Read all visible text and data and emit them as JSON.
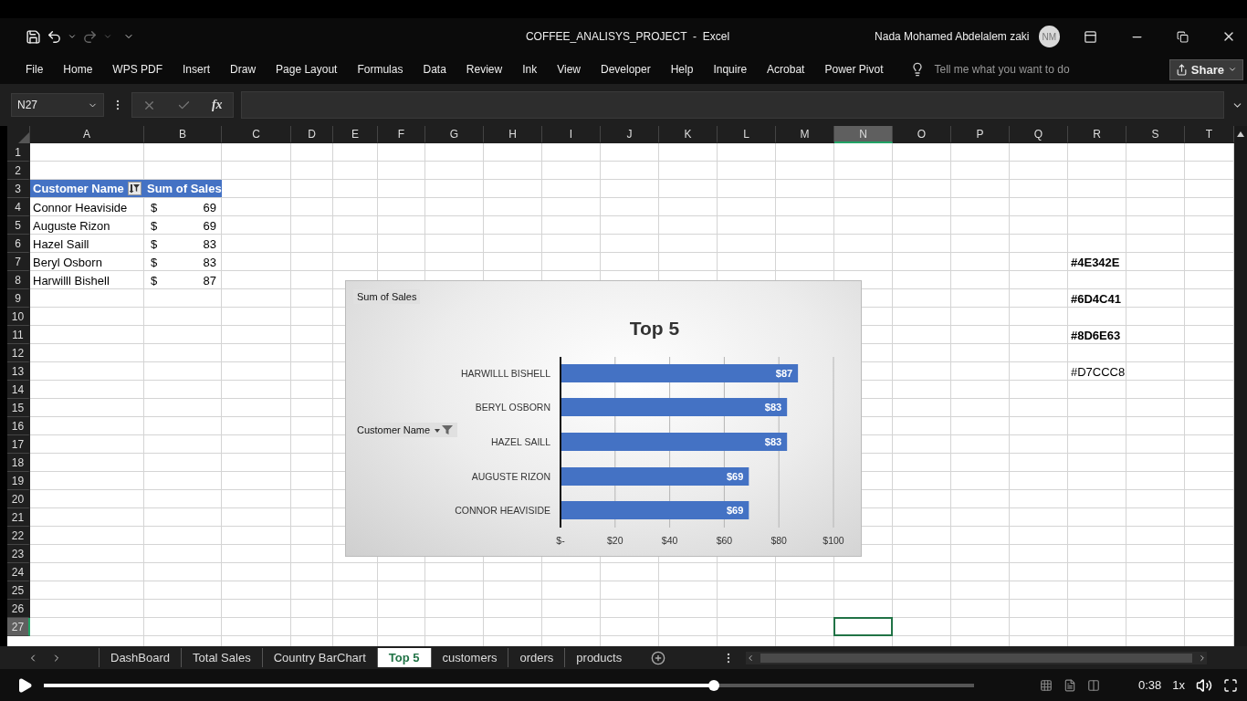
{
  "window": {
    "title": "COFFEE_ANALISYS_PROJECT  -  Excel",
    "user": "Nada Mohamed Abdelalem zaki",
    "avatar": "NM"
  },
  "ribbon_tabs": [
    "File",
    "Home",
    "WPS PDF",
    "Insert",
    "Draw",
    "Page Layout",
    "Formulas",
    "Data",
    "Review",
    "Ink",
    "View",
    "Developer",
    "Help",
    "Inquire",
    "Acrobat",
    "Power Pivot"
  ],
  "tell_me": {
    "placeholder": "Tell me what you want to do"
  },
  "share_button": "Share",
  "name_box": "N27",
  "function_label": "fx",
  "columns": [
    {
      "label": "A",
      "selected": false
    },
    {
      "label": "B",
      "selected": false
    },
    {
      "label": "C",
      "selected": false
    },
    {
      "label": "D",
      "selected": false
    },
    {
      "label": "E",
      "selected": false
    },
    {
      "label": "F",
      "selected": false
    },
    {
      "label": "G",
      "selected": false
    },
    {
      "label": "H",
      "selected": false
    },
    {
      "label": "I",
      "selected": false
    },
    {
      "label": "J",
      "selected": false
    },
    {
      "label": "K",
      "selected": false
    },
    {
      "label": "L",
      "selected": false
    },
    {
      "label": "M",
      "selected": false
    },
    {
      "label": "N",
      "selected": true
    },
    {
      "label": "O",
      "selected": false
    },
    {
      "label": "P",
      "selected": false
    },
    {
      "label": "Q",
      "selected": false
    },
    {
      "label": "R",
      "selected": false
    },
    {
      "label": "S",
      "selected": false
    },
    {
      "label": "T",
      "selected": false
    }
  ],
  "rows": [
    {
      "label": "1",
      "selected": false
    },
    {
      "label": "2",
      "selected": false
    },
    {
      "label": "3",
      "selected": false
    },
    {
      "label": "4",
      "selected": false
    },
    {
      "label": "5",
      "selected": false
    },
    {
      "label": "6",
      "selected": false
    },
    {
      "label": "7",
      "selected": false
    },
    {
      "label": "8",
      "selected": false
    },
    {
      "label": "9",
      "selected": false
    },
    {
      "label": "10",
      "selected": false
    },
    {
      "label": "11",
      "selected": false
    },
    {
      "label": "12",
      "selected": false
    },
    {
      "label": "13",
      "selected": false
    },
    {
      "label": "14",
      "selected": false
    },
    {
      "label": "15",
      "selected": false
    },
    {
      "label": "16",
      "selected": false
    },
    {
      "label": "17",
      "selected": false
    },
    {
      "label": "18",
      "selected": false
    },
    {
      "label": "19",
      "selected": false
    },
    {
      "label": "20",
      "selected": false
    },
    {
      "label": "21",
      "selected": false
    },
    {
      "label": "22",
      "selected": false
    },
    {
      "label": "23",
      "selected": false
    },
    {
      "label": "24",
      "selected": false
    },
    {
      "label": "25",
      "selected": false
    },
    {
      "label": "26",
      "selected": false
    },
    {
      "label": "27",
      "selected": true
    }
  ],
  "pivot_table": {
    "row_field": "Customer Name",
    "value_field": "Sum of Sales",
    "rows": [
      {
        "name": "Connor Heaviside",
        "symbol": "$",
        "value": "69"
      },
      {
        "name": "Auguste Rizon",
        "symbol": "$",
        "value": "69"
      },
      {
        "name": "Hazel Saill",
        "symbol": "$",
        "value": "83"
      },
      {
        "name": "Beryl Osborn",
        "symbol": "$",
        "value": "83"
      },
      {
        "name": "Harwilll Bishell",
        "symbol": "$",
        "value": "87"
      }
    ]
  },
  "color_notes": [
    {
      "text": "#4E342E",
      "bold": true
    },
    {
      "text": "#6D4C41",
      "bold": true
    },
    {
      "text": "#8D6E63",
      "bold": true
    },
    {
      "text": "#D7CCC8",
      "bold": false
    }
  ],
  "chart": {
    "axis_button": "Customer Name",
    "chart_data": {
      "type": "bar",
      "orientation": "horizontal",
      "title": "Top 5",
      "categories": [
        "HARWILLL BISHELL",
        "BERYL OSBORN",
        "HAZEL SAILL",
        "AUGUSTE RIZON",
        "CONNOR HEAVISIDE"
      ],
      "series": [
        {
          "name": "Sum of Sales",
          "color": "#4472c4",
          "values": [
            87,
            83,
            83,
            69,
            69
          ]
        }
      ],
      "xlim": [
        0,
        100
      ],
      "xticks": [
        {
          "value": 0,
          "label": "$-"
        },
        {
          "value": 20,
          "label": "$20"
        },
        {
          "value": 40,
          "label": "$40"
        },
        {
          "value": 60,
          "label": "$60"
        },
        {
          "value": 80,
          "label": "$80"
        },
        {
          "value": 100,
          "label": "$100"
        }
      ],
      "grid": true,
      "value_labels": [
        "$87",
        "$83",
        "$83",
        "$69",
        "$69"
      ]
    }
  },
  "sheet_tabs": [
    {
      "label": "DashBoard",
      "selected": false
    },
    {
      "label": "Total Sales",
      "selected": false
    },
    {
      "label": "Country BarChart",
      "selected": false
    },
    {
      "label": "Top 5",
      "selected": true
    },
    {
      "label": "customers",
      "selected": false
    },
    {
      "label": "orders",
      "selected": false
    },
    {
      "label": "products",
      "selected": false
    }
  ],
  "video_player": {
    "level": 0.72,
    "time": "0:38",
    "speed": "1x"
  }
}
